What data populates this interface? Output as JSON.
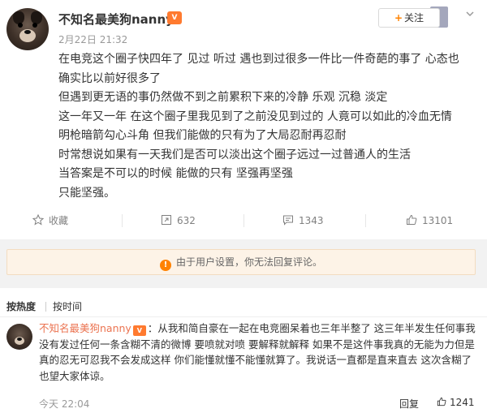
{
  "post": {
    "username": "不知名最美狗nanny",
    "badge": "V",
    "time": "2月22日 21:32",
    "follow_label": "关注",
    "content_lines": [
      "在电竞这个圈子快四年了 见过 听过 遇也到过很多一件比一件奇葩的事了 心态也",
      "确实比以前好很多了",
      "但遇到更无语的事仍然做不到之前累积下来的冷静 乐观 沉稳 淡定",
      "这一年又一年 在这个圈子里我见到了之前没见到过的 人竟可以如此的冷血无情",
      "明枪暗箭勾心斗角 但我们能做的只有为了大局忍耐再忍耐",
      "时常想说如果有一天我们是否可以淡出这个圈子远过一过普通人的生活",
      "当答案是不可以的时候 能做的只有 坚强再坚强",
      "只能坚强。"
    ],
    "actions": {
      "favorite_label": "收藏",
      "repost_count": "632",
      "comment_count": "1343",
      "like_count": "13101"
    }
  },
  "notice": {
    "text": "由于用户设置，你无法回复评论。"
  },
  "comments": {
    "sort_hot": "按热度",
    "sort_time": "按时间",
    "items": [
      {
        "username": "不知名最美狗nanny",
        "badge": "V",
        "lines": [
          "：从我和简自豪在一起在电竞圈呆着也三年半整了 这三年半发生任何事我",
          "没有发过任何一条含糊不清的微博 要喷就对喷 要解释就解释 如果不是这件事我真的无能为力但是",
          "真的忍无可忍我不会发成这样 你们能懂就懂不能懂就算了。我说话一直都是直来直去 这次含糊了",
          "也望大家体谅。"
        ],
        "time": "今天 22:04",
        "reply_label": "回复",
        "like_count": "1241"
      }
    ]
  },
  "colors": {
    "username_link": "#eb7350",
    "accent": "#ff8200",
    "notice_bg": "#fdf3e7"
  }
}
